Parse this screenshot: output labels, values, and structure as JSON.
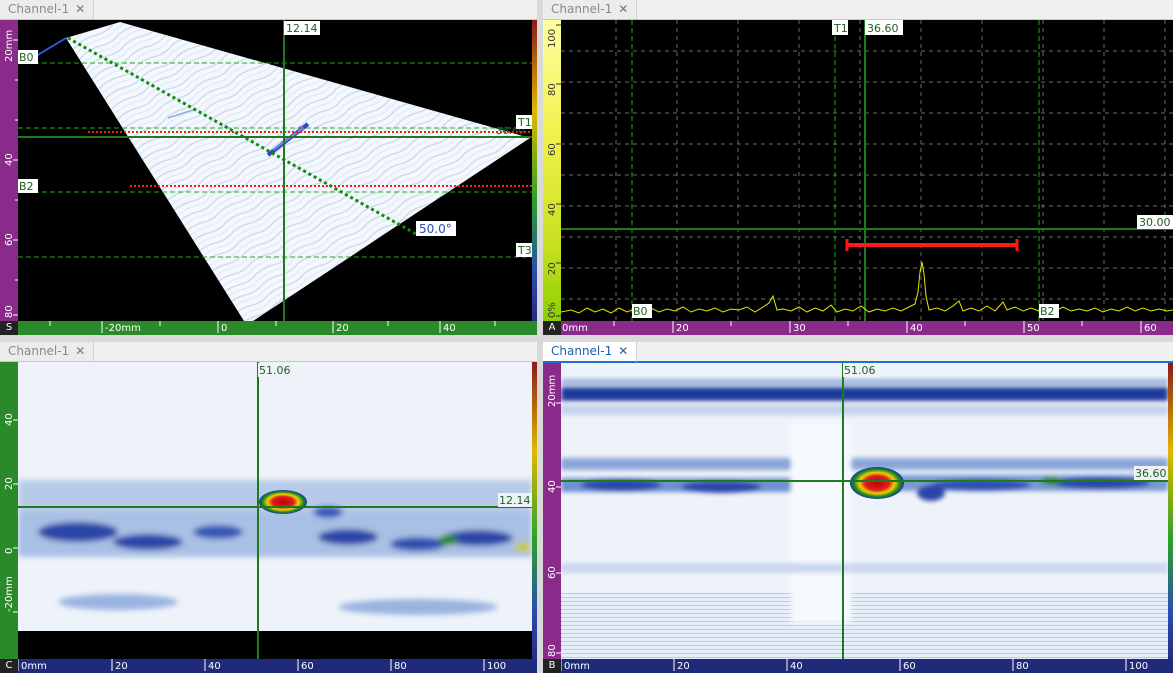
{
  "panels": {
    "s_scan": {
      "tab": "Channel-1",
      "view_label": "S",
      "y_ticks": [
        "20mm",
        "40",
        "60",
        "80"
      ],
      "x_ticks": [
        "-20mm",
        "0",
        "20",
        "40"
      ],
      "cursor_x": "12.14",
      "cursor_y": "36.60",
      "markers": {
        "b0": "B0",
        "b2": "B2",
        "t1": "T1",
        "t3": "T3"
      },
      "angle": "50.0°"
    },
    "a_scan": {
      "tab": "Channel-1",
      "view_label": "A",
      "y_ticks": [
        "100",
        "80",
        "60",
        "40",
        "20",
        "0%"
      ],
      "x_ticks": [
        "0mm",
        "20",
        "30",
        "40",
        "50",
        "60"
      ],
      "cursor_t1": "T1",
      "cursor_x": "36.60",
      "cursor_y": "30.00",
      "markers": {
        "b0": "B0",
        "b2": "B2"
      }
    },
    "c_scan": {
      "tab": "Channel-1",
      "view_label": "C",
      "y_ticks": [
        "40",
        "20",
        "0",
        "-20mm"
      ],
      "x_ticks": [
        "0mm",
        "20",
        "40",
        "60",
        "80",
        "100"
      ],
      "cursor_x": "51.06",
      "cursor_y": "12.14"
    },
    "b_scan": {
      "tab": "Channel-1",
      "view_label": "B",
      "y_ticks": [
        "20mm",
        "40",
        "60",
        "80"
      ],
      "x_ticks": [
        "0mm",
        "20",
        "40",
        "60",
        "80",
        "100"
      ],
      "cursor_x": "51.06",
      "cursor_y": "36.60"
    }
  },
  "colors": {
    "cursor": "#1e7a1e",
    "sbar": "#8a2a8a",
    "cbar": "#2a8a2a",
    "bbar": "#1f2a7a",
    "gate": "#ff1a1a",
    "ascan_signal": "#e6e600"
  }
}
